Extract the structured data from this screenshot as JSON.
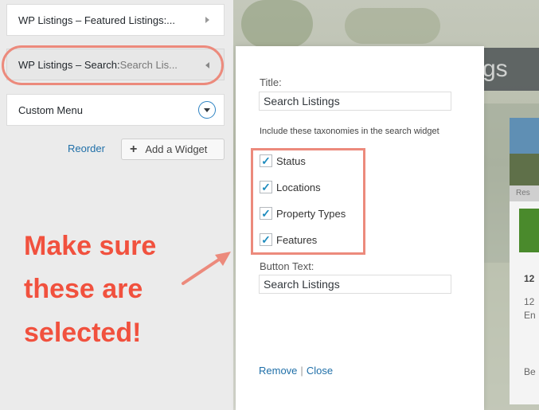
{
  "sidebar": {
    "widgets": [
      {
        "title": "WP Listings – Featured Listings:..."
      },
      {
        "title": "WP Listings – Search:",
        "subtitle": " Search Lis..."
      },
      {
        "title": "Custom Menu"
      }
    ],
    "reorder_label": "Reorder",
    "add_widget_label": "Add a Widget"
  },
  "annotation": {
    "lines": [
      "Make sure",
      "these are",
      "selected!"
    ],
    "color": "#f1513e"
  },
  "panel": {
    "title_label": "Title:",
    "title_value": "Search Listings",
    "taxonomy_help": "Include these taxonomies in the search widget",
    "taxonomies": [
      {
        "label": "Status",
        "checked": true
      },
      {
        "label": "Locations",
        "checked": true
      },
      {
        "label": "Property Types",
        "checked": true
      },
      {
        "label": "Features",
        "checked": true
      }
    ],
    "button_text_label": "Button Text:",
    "button_text_value": "Search Listings",
    "remove_label": "Remove",
    "separator": "|",
    "close_label": "Close"
  },
  "background_site": {
    "logo_fragment": "gs",
    "card_tag": "Res",
    "card_price": "12",
    "card_line1": "12",
    "card_line2": "En",
    "card_line3": "Be"
  },
  "colors": {
    "accent_link": "#1f6fa8",
    "highlight": "#ec8a7c",
    "checkbox_check": "#1e8cbe"
  }
}
